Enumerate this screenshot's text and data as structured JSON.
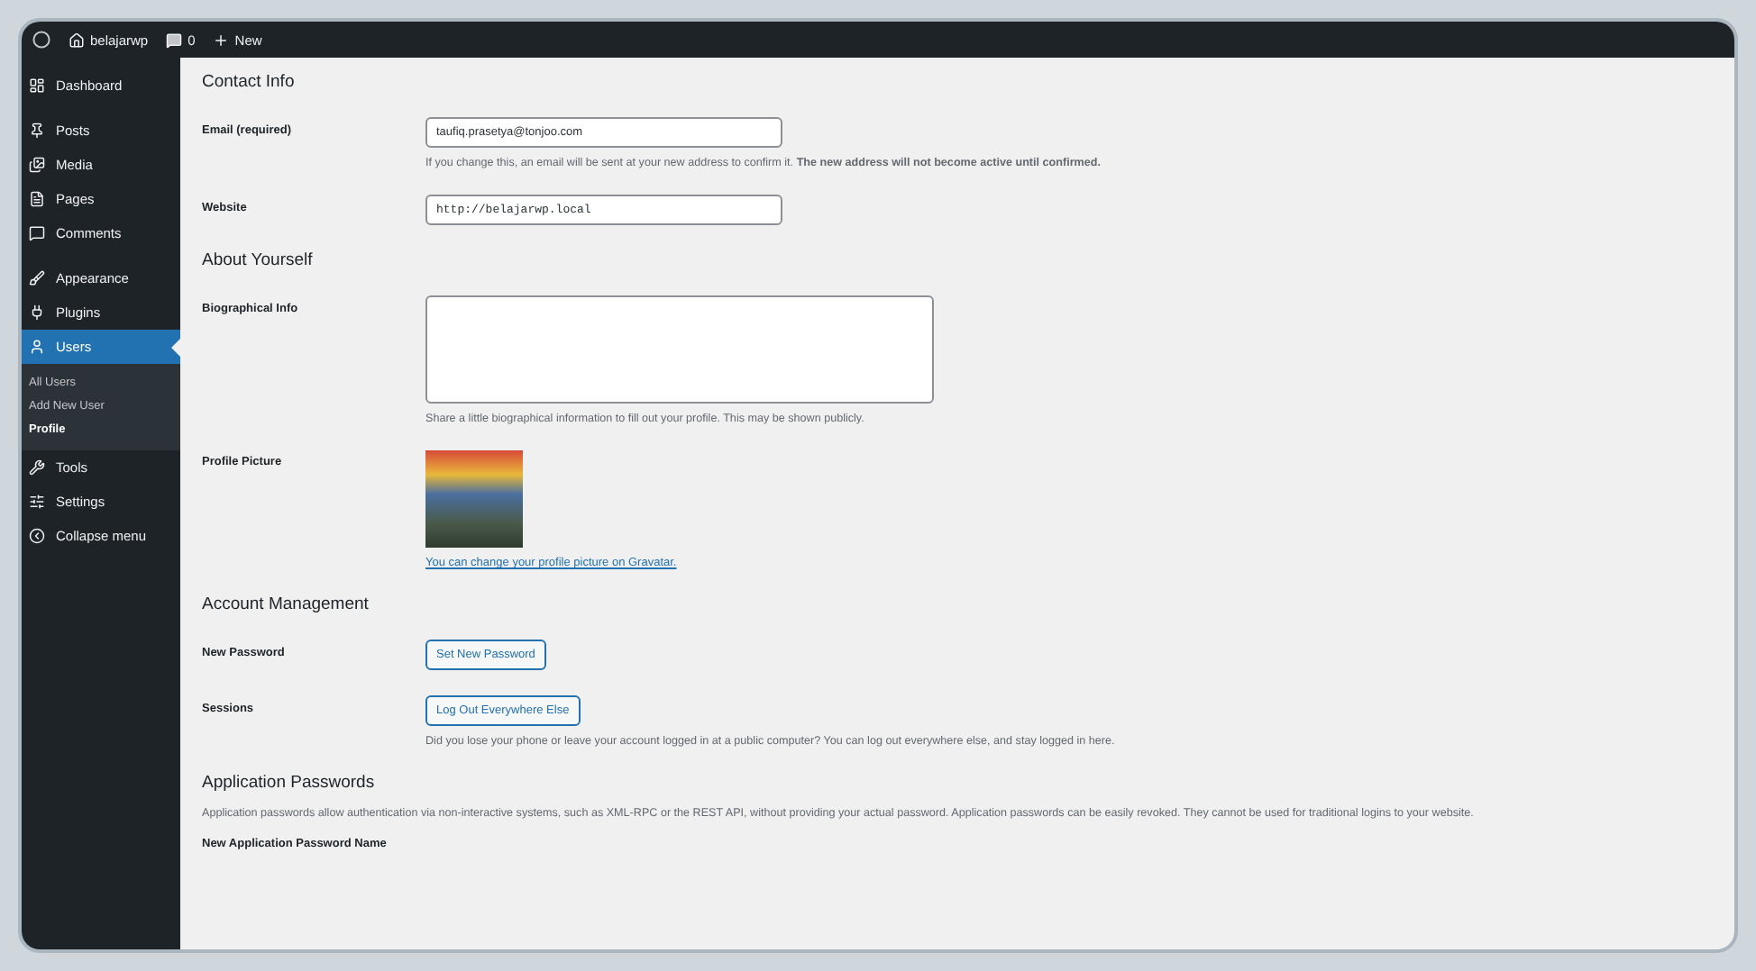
{
  "admin_bar": {
    "site_name": "belajarwp",
    "comments_count": "0",
    "new_label": "New"
  },
  "sidebar": {
    "groups": [
      {
        "items": [
          {
            "label": "Dashboard",
            "selected": false
          }
        ]
      },
      {
        "items": [
          {
            "label": "Posts",
            "selected": false
          },
          {
            "label": "Media",
            "selected": false
          },
          {
            "label": "Pages",
            "selected": false
          },
          {
            "label": "Comments",
            "selected": false
          }
        ]
      },
      {
        "items": [
          {
            "label": "Appearance",
            "selected": false
          },
          {
            "label": "Plugins",
            "selected": false
          },
          {
            "label": "Users",
            "selected": true,
            "children": [
              {
                "label": "All Users",
                "selected": false
              },
              {
                "label": "Add New User",
                "selected": false
              },
              {
                "label": "Profile",
                "selected": true
              }
            ]
          },
          {
            "label": "Tools",
            "selected": false
          },
          {
            "label": "Settings",
            "selected": false
          },
          {
            "label": "Collapse menu",
            "selected": false
          }
        ]
      }
    ]
  },
  "sections": [
    {
      "heading": "Contact Info",
      "rows": [
        {
          "kind": "input",
          "label": "Email (required)",
          "value": "taufiq.prasetya@tonjoo.com",
          "mono": false,
          "description": "If you change this, an email will be sent at your new address to confirm it. **The new address will not become active until confirmed.**"
        },
        {
          "kind": "input",
          "label": "Website",
          "value": "http://belajarwp.local",
          "mono": true
        }
      ]
    },
    {
      "heading": "About Yourself",
      "rows": [
        {
          "kind": "textarea",
          "label": "Biographical Info",
          "description": "Share a little biographical information to fill out your profile. This may be shown publicly."
        },
        {
          "kind": "avatar",
          "label": "Profile Picture",
          "link": "You can change your profile picture on Gravatar."
        }
      ]
    },
    {
      "heading": "Account Management",
      "rows": [
        {
          "kind": "button",
          "label": "New Password",
          "button": "Set New Password"
        },
        {
          "kind": "button",
          "label": "Sessions",
          "button": "Log Out Everywhere Else",
          "description": "Did you lose your phone or leave your account logged in at a public computer? You can log out everywhere else, and stay logged in here."
        }
      ]
    },
    {
      "heading": "Application Passwords",
      "intro": "Application passwords allow authentication via non-interactive systems, such as XML-RPC or the REST API, without providing your actual password. Application passwords can be easily revoked. They cannot be used for traditional logins to your website.",
      "rows": [
        {
          "kind": "label_only",
          "label": "New Application Password Name"
        }
      ]
    }
  ]
}
